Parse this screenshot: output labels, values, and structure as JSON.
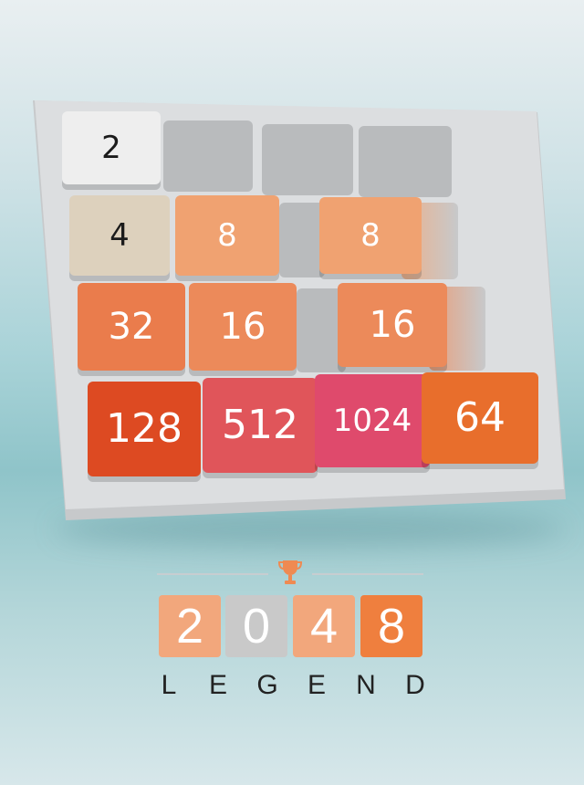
{
  "board": {
    "tiles": [
      {
        "value": "2",
        "color": "#eeeeee",
        "text_color": "#1b1b1b"
      },
      {
        "value": "4",
        "color": "#ddd1bd",
        "text_color": "#1b1b1b"
      },
      {
        "value": "8",
        "color": "#f0a271"
      },
      {
        "value": "8",
        "color": "#f0a271"
      },
      {
        "value": "32",
        "color": "#ea7c4c"
      },
      {
        "value": "16",
        "color": "#ec8a5a"
      },
      {
        "value": "16",
        "color": "#ec8a5a"
      },
      {
        "value": "128",
        "color": "#dd4a22"
      },
      {
        "value": "512",
        "color": "#e0555a"
      },
      {
        "value": "1024",
        "color": "#df4a6c"
      },
      {
        "value": "64",
        "color": "#e86e2c"
      }
    ]
  },
  "logo": {
    "digits": [
      {
        "value": "2",
        "color": "#f2a77c"
      },
      {
        "value": "0",
        "color": "#c9c9c9"
      },
      {
        "value": "4",
        "color": "#f2a77c"
      },
      {
        "value": "8",
        "color": "#ef7f3e"
      }
    ],
    "subtitle_letters": [
      "L",
      "E",
      "G",
      "E",
      "N",
      "D"
    ]
  },
  "colors": {
    "trophy": "#ef8a52",
    "empty_cell": "#b9bbbd",
    "board_face": "#dcdee0"
  },
  "icons": {
    "trophy": "trophy-icon"
  }
}
